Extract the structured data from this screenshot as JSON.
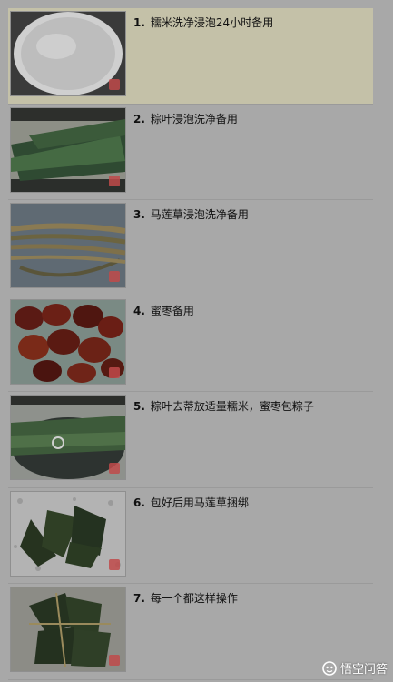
{
  "steps": [
    {
      "num": "1.",
      "text": "糯米洗净浸泡24小时备用",
      "image": "soaked glutinous rice"
    },
    {
      "num": "2.",
      "text": "粽叶浸泡洗净备用",
      "image": "zongzi leaves"
    },
    {
      "num": "3.",
      "text": "马莲草浸泡洗净备用",
      "image": "malan grass strings"
    },
    {
      "num": "4.",
      "text": "蜜枣备用",
      "image": "candied dates"
    },
    {
      "num": "5.",
      "text": "粽叶去蒂放适量糯米，蜜枣包粽子",
      "image": "leaves in pot"
    },
    {
      "num": "6.",
      "text": "包好后用马莲草捆绑",
      "image": "wrapped zongzi"
    },
    {
      "num": "7.",
      "text": "每一个都这样操作",
      "image": "bundled zongzi"
    }
  ],
  "brand": {
    "label": "悟空问答",
    "icon": "wukong-icon"
  },
  "colors": {
    "page_bg": "#a8a8a8",
    "highlight_bg": "#c4c1a8"
  }
}
